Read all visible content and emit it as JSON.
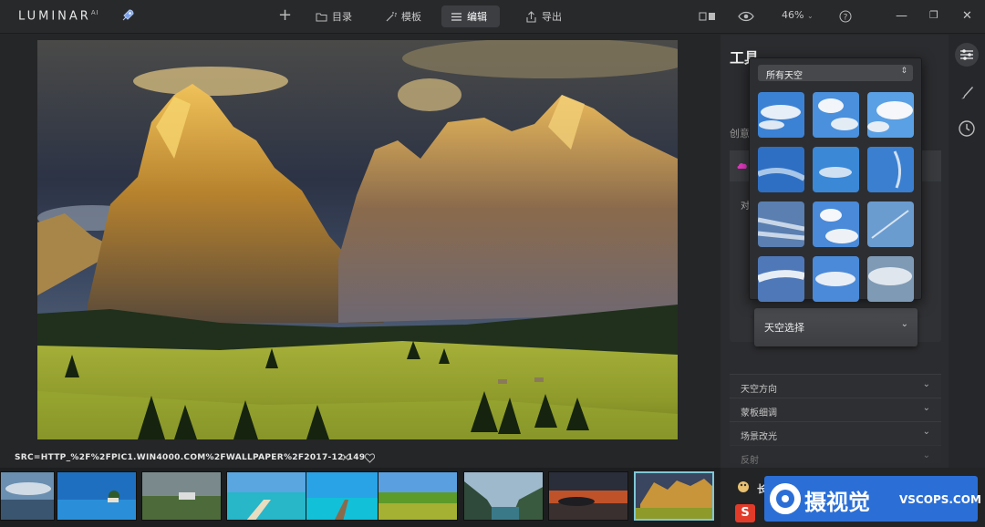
{
  "app": {
    "logo": "LUMINAR",
    "logo_sup": "AI"
  },
  "toolbar": {
    "catalog_label": "目录",
    "templates_label": "模板",
    "edit_label": "编辑",
    "export_label": "导出",
    "zoom": "46%"
  },
  "canvas": {
    "src_text": "SRC=HTTP_%2F%2FPIC1.WIN4000.COM%2FWALLPAPER%2F2017-12-149"
  },
  "panel": {
    "title": "工具",
    "creative_partial": "创意",
    "card_partial": "对",
    "sky_select_label": "天空选择",
    "sections": [
      {
        "label": "天空方向"
      },
      {
        "label": "蒙板细调"
      },
      {
        "label": "场景改光"
      },
      {
        "label": "反射"
      }
    ],
    "bottom_label": "长"
  },
  "sky_popup": {
    "selected": "所有天空",
    "count": 12
  },
  "filmstrip": {
    "count": 9,
    "selected_index": 8
  },
  "watermark": {
    "cn": "摄视觉",
    "en": "VSCOPS.COM"
  },
  "colors": {
    "accent_selected": "#7fc6d6",
    "watermark_bg": "#2b6fd6"
  }
}
